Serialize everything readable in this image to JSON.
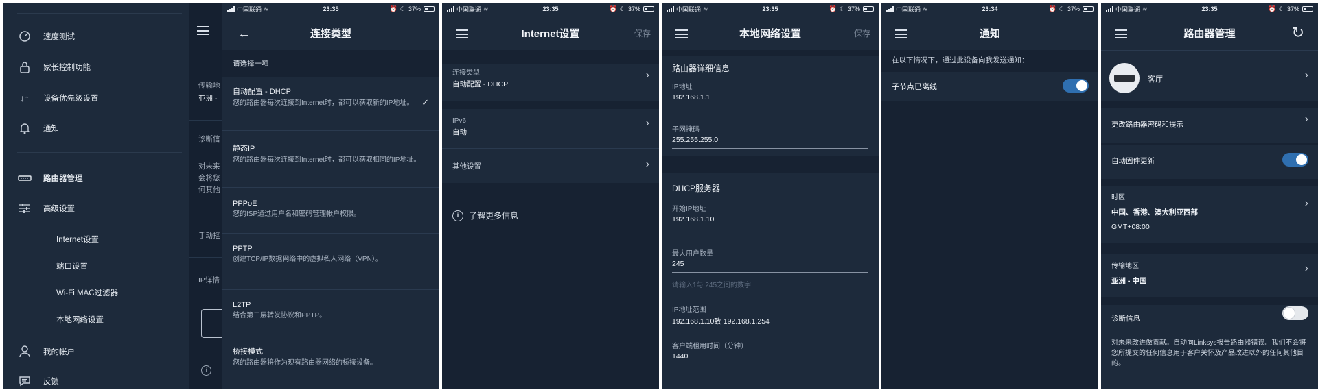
{
  "status_bar": {
    "carrier": "中国联通",
    "battery": "37%",
    "times": [
      "23:35",
      "23:35",
      "23:35",
      "23:34",
      "23:35"
    ]
  },
  "panel1": {
    "menu_items": [
      {
        "label": "速度测试",
        "icon": "speedometer-icon"
      },
      {
        "label": "家长控制功能",
        "icon": "parental-lock-icon"
      },
      {
        "label": "设备优先级设置",
        "icon": "priority-arrows-icon"
      },
      {
        "label": "通知",
        "icon": "bell-icon"
      }
    ],
    "router_mgmt": "路由器管理",
    "advanced": "高级设置",
    "sub_items": [
      "Internet设置",
      "端口设置",
      "Wi-Fi MAC过滤器",
      "本地网络设置"
    ],
    "account": "我的帐户",
    "feedback": "反馈",
    "overlay": {
      "region_label": "传输地",
      "region_value": "亚洲 -",
      "diag": "诊断信",
      "desc": [
        "对未来",
        "会将您",
        "何其他"
      ],
      "manual": "手动抠",
      "ip_detail": "IP详情"
    }
  },
  "panel2": {
    "title": "连接类型",
    "prompt": "请选择一项",
    "options": [
      {
        "title": "自动配置 - DHCP",
        "desc": "您的路由器每次连接到Internet时，都可以获取新的IP地址。",
        "selected": true
      },
      {
        "title": "静态IP",
        "desc": "您的路由器每次连接到Internet时，都可以获取相同的IP地址。",
        "selected": false
      },
      {
        "title": "PPPoE",
        "desc": "您的ISP通过用户名和密码管理帐户权限。",
        "selected": false
      },
      {
        "title": "PPTP",
        "desc": "创建TCP/IP数据网络中的虚拟私人网络（VPN）。",
        "selected": false
      },
      {
        "title": "L2TP",
        "desc": "结合第二层转发协议和PPTP。",
        "selected": false
      },
      {
        "title": "桥接模式",
        "desc": "您的路由器将作为现有路由器网络的桥接设备。",
        "selected": false
      }
    ]
  },
  "panel3": {
    "title": "Internet设置",
    "save": "保存",
    "conn_label": "连接类型",
    "conn_value": "自动配置 - DHCP",
    "ipv6_label": "IPv6",
    "ipv6_value": "自动",
    "other": "其他设置",
    "learn_more": "了解更多信息"
  },
  "panel4": {
    "title": "本地网络设置",
    "save": "保存",
    "router_section": "路由器详细信息",
    "ip_label": "IP地址",
    "ip_value": "192.168.1.1",
    "mask_label": "子网掩码",
    "mask_value": "255.255.255.0",
    "dhcp_section": "DHCP服务器",
    "start_label": "开始IP地址",
    "start_value": "192.168.1.10",
    "max_label": "最大用户数量",
    "max_value": "245",
    "max_hint": "请输入1与 245之间的数字",
    "range_label": "IP地址范围",
    "range_value": "192.168.1.10致 192.168.1.254",
    "lease_label": "客户端租用时间（分钟）",
    "lease_value": "1440"
  },
  "panel5": {
    "title": "通知",
    "intro": "在以下情况下，通过此设备向我发送通知：",
    "node_offline": "子节点已离线",
    "node_offline_on": true
  },
  "panel6": {
    "title": "路由器管理",
    "router_name": "客厅",
    "change_pw": "更改路由器密码和提示",
    "auto_fw": "自动固件更新",
    "auto_fw_on": true,
    "tz_label": "时区",
    "tz_value": "中国、香港、澳大利亚西部",
    "tz_offset": "GMT+08:00",
    "region_label": "传输地区",
    "region_value": "亚洲 - 中国",
    "diag_label": "诊断信息",
    "diag_on": false,
    "diag_desc": "对未来改进做贡献。自动向Linksys报告路由器错误。我们不会将您所提交的任何信息用于客户关怀及产品改进以外的任何其他目的。"
  }
}
